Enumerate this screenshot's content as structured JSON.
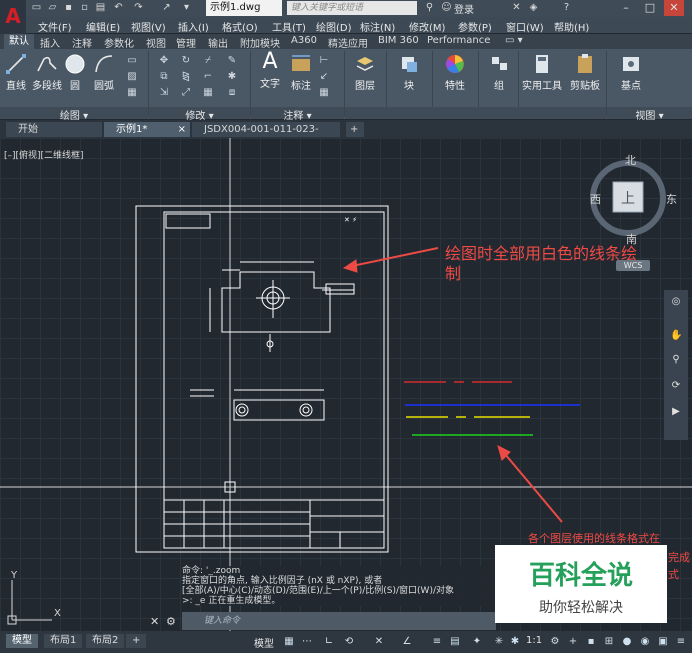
{
  "window": {
    "doc_title": "示例1.dwg",
    "search_placeholder": "键入关键字或短语",
    "login": "登录"
  },
  "menu": [
    "文件(F)",
    "编辑(E)",
    "视图(V)",
    "插入(I)",
    "格式(O)",
    "工具(T)",
    "绘图(D)",
    "标注(N)",
    "修改(M)",
    "参数(P)",
    "窗口(W)",
    "帮助(H)"
  ],
  "ribbon_tabs": [
    "默认",
    "插入",
    "注释",
    "参数化",
    "视图",
    "管理",
    "输出",
    "附加模块",
    "A360",
    "精选应用",
    "BIM 360",
    "Performance"
  ],
  "ribbon": {
    "draw_tools": [
      "直线",
      "多段线",
      "圆",
      "圆弧"
    ],
    "text_tool": "文字",
    "dim_tool": "标注",
    "layer_tool": "图层",
    "block_tool": "块",
    "props_tool": "特性",
    "group_tool": "组",
    "util_tool": "实用工具",
    "clip_tool": "剪贴板",
    "base_tool": "基点",
    "groups": [
      "绘图 ▾",
      "修改 ▾",
      "注释 ▾",
      "视图 ▾"
    ]
  },
  "file_tabs": [
    "开始",
    "示例1*",
    "JSDX004-001-011-023-010J*"
  ],
  "canvas": {
    "view_label": "[–][俯视][二维线框]",
    "viewcube": {
      "north": "北",
      "south": "南",
      "east": "东",
      "west": "西",
      "top": "上",
      "wcs": "WCS"
    }
  },
  "annotations": {
    "note1_line1": "绘图时全部用白色的线条绘",
    "note1_line2": "制",
    "note2": "各个图层使用的线条格式在",
    "note2_tail1": "完成",
    "note2_tail2": "式"
  },
  "command": {
    "history": [
      "命令: '_.zoom",
      "指定窗口的角点, 输入比例因子 (nX 或 nXP), 或者",
      "[全部(A)/中心(C)/动态(D)/范围(E)/上一个(P)/比例(S)/窗口(W)/对象",
      ">: _e 正在重生成模型。"
    ],
    "input_placeholder": "键入命令"
  },
  "layout_tabs": [
    "模型",
    "布局1",
    "布局2"
  ],
  "status": {
    "model": "模型",
    "scale": "1:1"
  },
  "watermark": {
    "title": "百科全说",
    "subtitle": "助你轻松解决"
  },
  "colors": {
    "canvas": "#212830",
    "red_line": "#d42a2a",
    "blue_line": "#1a33ff",
    "yellow_line": "#e8e000",
    "green_line": "#1fd01f",
    "annotation": "#f04a45"
  }
}
